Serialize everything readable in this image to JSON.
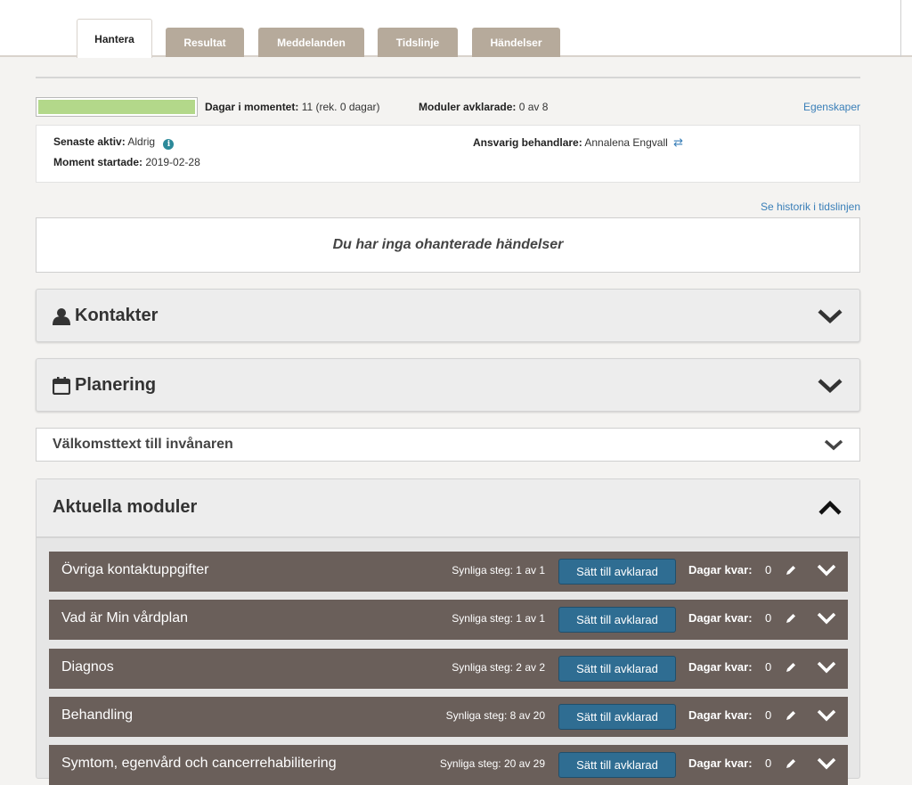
{
  "tabs": [
    {
      "label": "Hantera"
    },
    {
      "label": "Resultat"
    },
    {
      "label": "Meddelanden"
    },
    {
      "label": "Tidslinje"
    },
    {
      "label": "Händelser"
    }
  ],
  "status": {
    "progress_fraction": 1.0,
    "progress_color": "#b3d88a",
    "days_label": "Dagar i momentet:",
    "days_value": "11 (rek. 0 dagar)",
    "modules_label": "Moduler avklarade:",
    "modules_value": "0 av 8",
    "properties_link": "Egenskaper"
  },
  "info": {
    "last_active_label": "Senaste aktiv:",
    "last_active_value": "Aldrig",
    "info_icon": "i",
    "started_label": "Moment startade:",
    "started_value": "2019-02-28",
    "responsible_label": "Ansvarig behandlare:",
    "responsible_value": "Annalena Engvall",
    "swap_icon": "⇄"
  },
  "history_link": "Se historik i tidslinjen",
  "events_message": "Du har inga ohanterade händelser",
  "panels": {
    "contacts": "Kontakter",
    "planning": "Planering",
    "welcome": "Välkomsttext till invånaren",
    "current": "Aktuella moduler"
  },
  "modules": [
    {
      "name": "Övriga kontaktuppgifter",
      "steps": "Synliga steg: 1 av 1",
      "button": "Sätt till avklarad",
      "days_label": "Dagar kvar:",
      "days_value": "0"
    },
    {
      "name": "Vad är Min vårdplan",
      "steps": "Synliga steg: 1 av 1",
      "button": "Sätt till avklarad",
      "days_label": "Dagar kvar:",
      "days_value": "0"
    },
    {
      "name": "Diagnos",
      "steps": "Synliga steg: 2 av 2",
      "button": "Sätt till avklarad",
      "days_label": "Dagar kvar:",
      "days_value": "0"
    },
    {
      "name": "Behandling",
      "steps": "Synliga steg: 8 av 20",
      "button": "Sätt till avklarad",
      "days_label": "Dagar kvar:",
      "days_value": "0"
    },
    {
      "name": "Symtom, egenvård och cancerrehabilitering",
      "steps": "Synliga steg: 20 av 29",
      "button": "Sätt till avklarad",
      "days_label": "Dagar kvar:",
      "days_value": "0"
    }
  ]
}
